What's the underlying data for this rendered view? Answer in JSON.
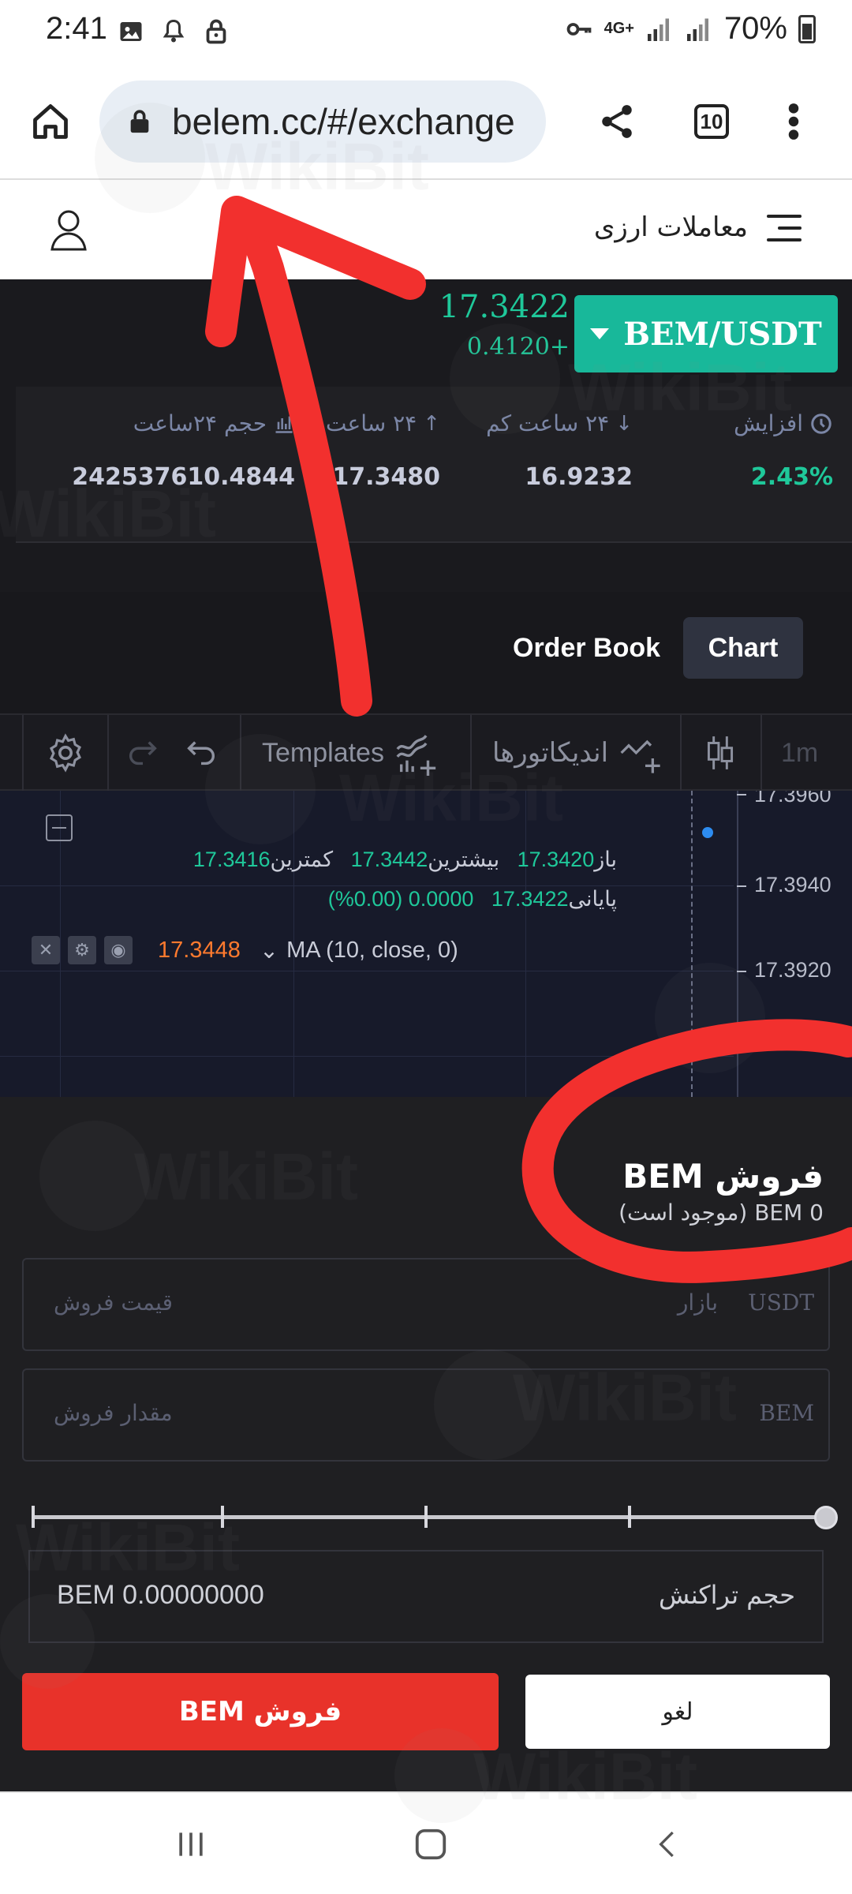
{
  "status_bar": {
    "time": "2:41",
    "network": "4G+",
    "battery": "70%"
  },
  "browser": {
    "url": "belem.cc/#/exchange",
    "tab_count": "10"
  },
  "site_header": {
    "title": "معاملات ارزی"
  },
  "ticker": {
    "pair": "BEM/USDT",
    "last_price": "17.3422",
    "change": "0.4120+",
    "stats": [
      {
        "label": "افزایش",
        "value": "2.43%"
      },
      {
        "label": "۲۴ ساعت کم",
        "value": "16.9232"
      },
      {
        "label": "۲۴ ساعت",
        "value": "17.3480"
      },
      {
        "label": "حجم ۲۴ساعت",
        "value": "242537610.4844"
      }
    ]
  },
  "tabs": {
    "chart": "Chart",
    "order_book": "Order Book"
  },
  "chart_toolbar": {
    "interval": "1m",
    "indicators": "اندیکاتورها",
    "templates": "Templates"
  },
  "chart": {
    "ohlc_row1": {
      "open_label": "باز",
      "open": "17.3420",
      "high_label": "بیشترین",
      "high": "17.3442",
      "low_label": "کمترین",
      "low": "17.3416"
    },
    "ohlc_row2": {
      "close_label": "پایانی",
      "close": "17.3422",
      "change": "0.0000 (0.00%)"
    },
    "ma_label": "MA (10, close, 0)",
    "ma_value": "17.3448",
    "price_axis": [
      "17.3960",
      "17.3940",
      "17.3920"
    ]
  },
  "sell_panel": {
    "title": "فروش BEM",
    "available": "BEM 0",
    "available_suffix": "(موجود است)",
    "price_placeholder": "قیمت فروش",
    "price_unit": "USDT",
    "price_market": "بازار",
    "amount_placeholder": "مقدار فروش",
    "amount_unit": "BEM",
    "volume_label": "حجم تراکنش",
    "volume_value": "BEM 0.00000000",
    "sell_button": "فروش BEM",
    "cancel_button": "لغو"
  },
  "watermark": "WikiBit",
  "colors": {
    "accent_green": "#18b89a",
    "sell_red": "#e8322a",
    "annotation_red": "#f2302e"
  }
}
